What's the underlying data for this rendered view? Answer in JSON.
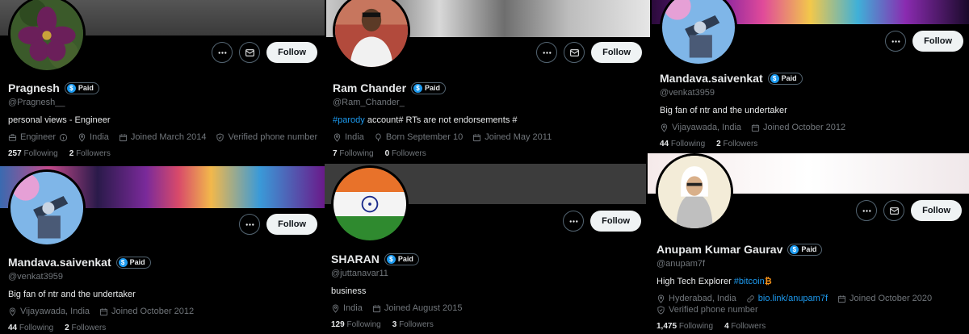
{
  "colors": {
    "background": "#000000",
    "accent": "#1d9bf0",
    "muted": "#71767b",
    "follow_bg": "#eff3f4"
  },
  "profiles": [
    {
      "name": "Pragnesh",
      "badge": "Paid",
      "handle": "@Pragnesh__",
      "bio": "personal views - Engineer",
      "meta": [
        {
          "icon": "briefcase-icon",
          "text": "Engineer"
        },
        {
          "icon": "location-icon",
          "text": "India"
        },
        {
          "icon": "calendar-icon",
          "text": "Joined March 2014"
        },
        {
          "icon": "shield-check-icon",
          "text": "Verified phone number"
        }
      ],
      "following_count": "257",
      "following_label": "Following",
      "followers_count": "2",
      "followers_label": "Followers",
      "follow_label": "Follow"
    },
    {
      "name": "Ram Chander",
      "badge": "Paid",
      "handle": "@Ram_Chander_",
      "bio_hashtag": "#parody",
      "bio_rest": " account# RTs are not endorsements #",
      "meta": [
        {
          "icon": "location-icon",
          "text": "India"
        },
        {
          "icon": "balloon-icon",
          "text": "Born September 10"
        },
        {
          "icon": "calendar-icon",
          "text": "Joined May 2011"
        }
      ],
      "following_count": "7",
      "following_label": "Following",
      "followers_count": "0",
      "followers_label": "Followers",
      "follow_label": "Follow"
    },
    {
      "name": "Mandava.saivenkat",
      "badge": "Paid",
      "handle": "@venkat3959",
      "bio": "Big fan of ntr and the undertaker",
      "meta": [
        {
          "icon": "location-icon",
          "text": "Vijayawada, India"
        },
        {
          "icon": "calendar-icon",
          "text": "Joined October 2012"
        }
      ],
      "following_count": "44",
      "following_label": "Following",
      "followers_count": "2",
      "followers_label": "Followers",
      "follow_label": "Follow"
    },
    {
      "name": "Mandava.saivenkat",
      "badge": "Paid",
      "handle": "@venkat3959",
      "bio": "Big fan of ntr and the undertaker",
      "meta": [
        {
          "icon": "location-icon",
          "text": "Vijayawada, India"
        },
        {
          "icon": "calendar-icon",
          "text": "Joined October 2012"
        }
      ],
      "following_count": "44",
      "following_label": "Following",
      "followers_count": "2",
      "followers_label": "Followers",
      "follow_label": "Follow"
    },
    {
      "name": "SHARAN",
      "badge": "Paid",
      "handle": "@juttanavar11",
      "bio": "business",
      "meta": [
        {
          "icon": "location-icon",
          "text": "India"
        },
        {
          "icon": "calendar-icon",
          "text": "Joined August 2015"
        }
      ],
      "following_count": "129",
      "following_label": "Following",
      "followers_count": "3",
      "followers_label": "Followers",
      "follow_label": "Follow"
    },
    {
      "name": "Anupam Kumar Gaurav",
      "badge": "Paid",
      "handle": "@anupam7f",
      "bio_text": "High Tech Explorer ",
      "bio_hashtag": "#bitcoin",
      "bio_emoji": "₿",
      "meta": [
        {
          "icon": "location-icon",
          "text": "Hyderabad, India"
        },
        {
          "icon": "link-icon",
          "text": "bio.link/anupam7f"
        },
        {
          "icon": "calendar-icon",
          "text": "Joined October 2020"
        },
        {
          "icon": "shield-check-icon",
          "text": "Verified phone number"
        }
      ],
      "following_count": "1,475",
      "following_label": "Following",
      "followers_count": "4",
      "followers_label": "Followers",
      "follow_label": "Follow"
    }
  ]
}
